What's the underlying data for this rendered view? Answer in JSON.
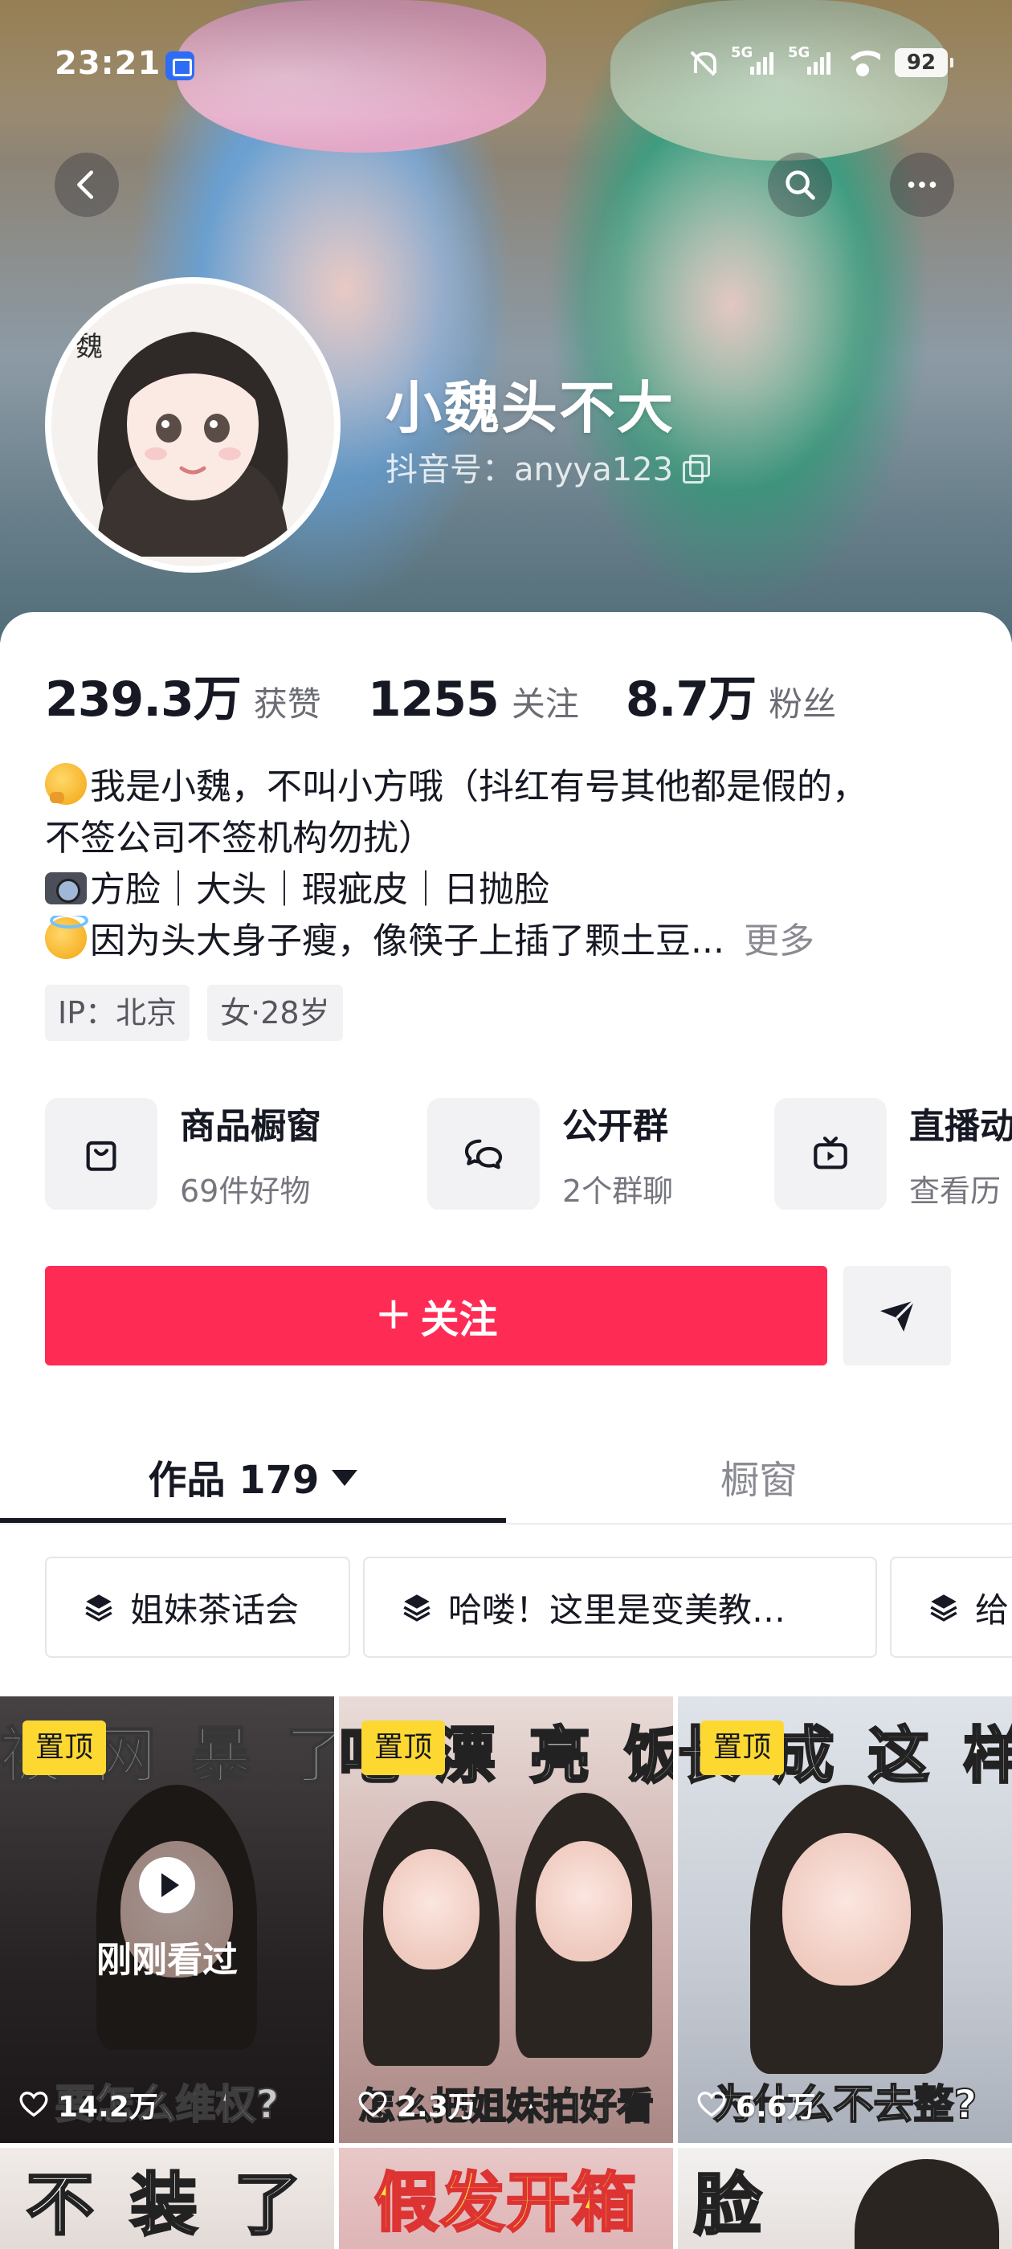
{
  "status_bar": {
    "time": "23:21",
    "network_1": "5G",
    "network_2": "5G",
    "battery": "92"
  },
  "profile": {
    "nickname": "小魏头不大",
    "douyin_id": "抖音号：anyya123",
    "avatar_text": "魏"
  },
  "stats": [
    {
      "value": "239.3万",
      "label": "获赞"
    },
    {
      "value": "1255",
      "label": "关注"
    },
    {
      "value": "8.7万",
      "label": "粉丝"
    }
  ],
  "bio": {
    "line1": "我是小魏，不叫小方哦（抖红有号其他都是假的，",
    "line2": "不签公司不签机构勿扰）",
    "line3": "方脸｜大头｜瑕疵皮｜日抛脸",
    "line4": "因为头大身子瘦，像筷子上插了颗土豆...",
    "more": "更多"
  },
  "tags": [
    "IP：北京",
    "女·28岁"
  ],
  "services": [
    {
      "title": "商品橱窗",
      "subtitle": "69件好物",
      "icon": "shopping-bag-icon"
    },
    {
      "title": "公开群",
      "subtitle": "2个群聊",
      "icon": "chat-bubbles-icon"
    },
    {
      "title": "直播动",
      "subtitle": "查看历",
      "icon": "tv-icon"
    }
  ],
  "actions": {
    "follow_label": "关注",
    "message_icon": "send-icon"
  },
  "tabs": {
    "works": "作品 179",
    "showcase": "橱窗"
  },
  "collections": [
    "姐妹茶话会",
    "哈喽！这里是变美教…",
    "给"
  ],
  "videos": [
    {
      "pinned": "置顶",
      "top_caption": "被 网 暴 了",
      "bottom_caption": "要怎么维权?",
      "likes": "14.2万",
      "watched": "刚刚看过"
    },
    {
      "pinned": "置顶",
      "top_caption": "吃 漂 亮 饭",
      "bottom_caption": "怎么把姐妹拍好看",
      "likes": "2.3万"
    },
    {
      "pinned": "置顶",
      "top_caption": "长 成 这 样",
      "bottom_caption": "为什么不去整?",
      "likes": "6.6万"
    },
    {
      "top_caption": "不 装 了"
    },
    {
      "top_caption": "假发开箱"
    },
    {
      "top_caption": "脸"
    }
  ],
  "colors": {
    "accent": "#fe2c55",
    "pin_badge": "#fdd831",
    "text_primary": "#161823",
    "text_secondary": "#8a8b92"
  }
}
